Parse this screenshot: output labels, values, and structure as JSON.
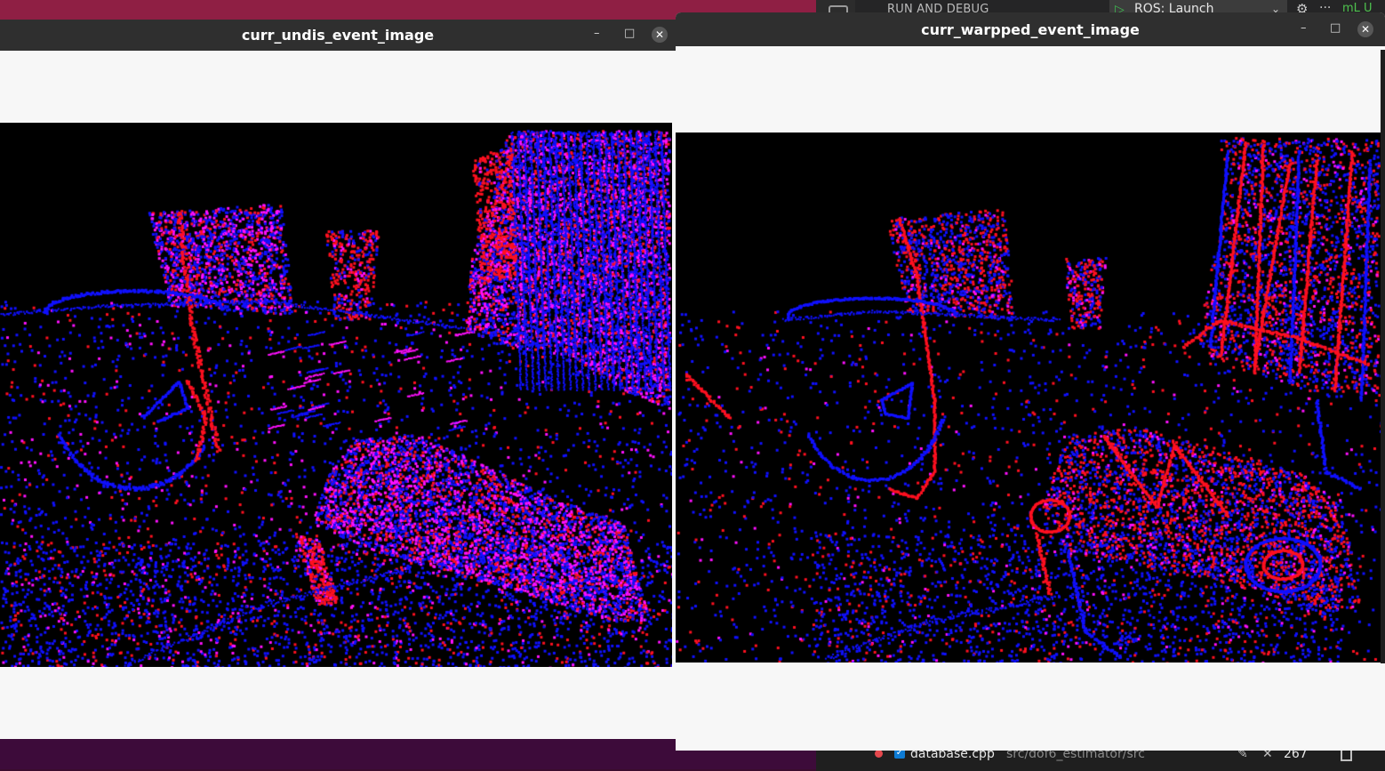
{
  "desktop": {
    "top_color": "#8f1f44",
    "bottom_color": "#3d0b3a"
  },
  "vscode": {
    "run_debug_label": "RUN AND DEBUG",
    "launch_config": "ROS: Launch",
    "play_icon": "play-icon",
    "gear_icon": "gear-icon",
    "more_icon": "ellipsis-icon",
    "badge": "mL U",
    "status": {
      "file": "database.cpp",
      "path": "src/dof6_estimator/src",
      "count": "267"
    }
  },
  "windows": {
    "left": {
      "title": "curr_undis_event_image",
      "minimize_glyph": "–",
      "maximize_glyph": "□",
      "close_glyph": "✕"
    },
    "right": {
      "title": "curr_warpped_event_image",
      "minimize_glyph": "–",
      "maximize_glyph": "□",
      "close_glyph": "✕"
    }
  },
  "event_colors": {
    "positive": "#ff1020",
    "negative": "#1010ff",
    "overlap": "#ff10ff",
    "background": "#000000"
  }
}
